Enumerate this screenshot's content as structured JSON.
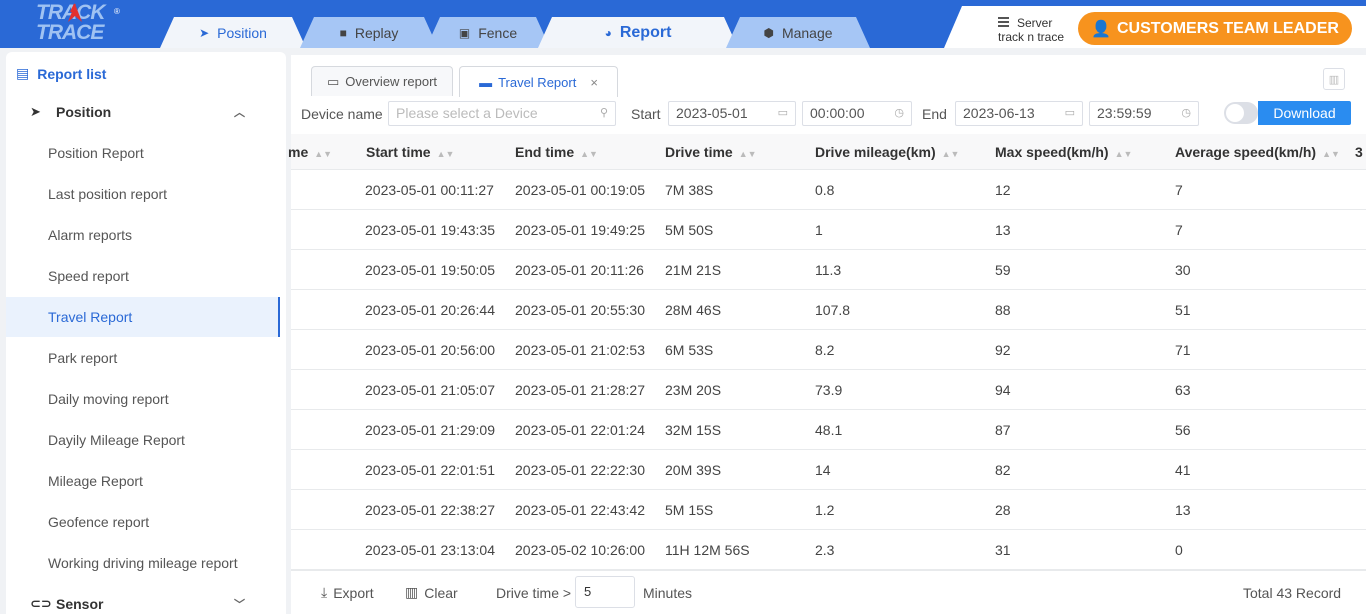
{
  "logo": {
    "line1": "TRACK",
    "line2": "TRACE",
    "mark": "®"
  },
  "nav_tabs": [
    {
      "label": "Position",
      "icon": "paper-plane-icon"
    },
    {
      "label": "Replay",
      "icon": "video-icon"
    },
    {
      "label": "Fence",
      "icon": "fence-icon"
    },
    {
      "label": "Report",
      "icon": "pie-chart-icon"
    },
    {
      "label": "Manage",
      "icon": "cube-icon"
    }
  ],
  "server": {
    "label": "Server",
    "name": "track n trace"
  },
  "user": {
    "name": "CUSTOMERS TEAM LEADER"
  },
  "sidebar": {
    "title": "Report list",
    "groups": [
      {
        "label": "Position",
        "expanded": true
      },
      {
        "label": "Sensor",
        "expanded": false
      }
    ],
    "items": [
      "Position Report",
      "Last position report",
      "Alarm reports",
      "Speed report",
      "Travel Report",
      "Park report",
      "Daily moving report",
      "Dayily Mileage Report",
      "Mileage Report",
      "Geofence report",
      "Working driving mileage report"
    ],
    "active_item": "Travel Report"
  },
  "report_tabs": [
    {
      "label": "Overview report"
    },
    {
      "label": "Travel Report",
      "close": "×"
    }
  ],
  "filters": {
    "device_label": "Device name",
    "device_placeholder": "Please select a Device",
    "start_label": "Start",
    "start_date": "2023-05-01",
    "start_time": "00:00:00",
    "end_label": "End",
    "end_date": "2023-06-13",
    "end_time": "23:59:59",
    "download_label": "Download"
  },
  "table": {
    "columns": [
      "me",
      "Start time",
      "End time",
      "Drive time",
      "Drive mileage(km)",
      "Max speed(km/h)",
      "Average speed(km/h)",
      "3"
    ],
    "rows": [
      [
        "2023-05-01 00:11:27",
        "2023-05-01 00:19:05",
        "7M 38S",
        "0.8",
        "12",
        "7"
      ],
      [
        "2023-05-01 19:43:35",
        "2023-05-01 19:49:25",
        "5M 50S",
        "1",
        "13",
        "7"
      ],
      [
        "2023-05-01 19:50:05",
        "2023-05-01 20:11:26",
        "21M 21S",
        "11.3",
        "59",
        "30"
      ],
      [
        "2023-05-01 20:26:44",
        "2023-05-01 20:55:30",
        "28M 46S",
        "107.8",
        "88",
        "51"
      ],
      [
        "2023-05-01 20:56:00",
        "2023-05-01 21:02:53",
        "6M 53S",
        "8.2",
        "92",
        "71"
      ],
      [
        "2023-05-01 21:05:07",
        "2023-05-01 21:28:27",
        "23M 20S",
        "73.9",
        "94",
        "63"
      ],
      [
        "2023-05-01 21:29:09",
        "2023-05-01 22:01:24",
        "32M 15S",
        "48.1",
        "87",
        "56"
      ],
      [
        "2023-05-01 22:01:51",
        "2023-05-01 22:22:30",
        "20M 39S",
        "14",
        "82",
        "41"
      ],
      [
        "2023-05-01 22:38:27",
        "2023-05-01 22:43:42",
        "5M 15S",
        "1.2",
        "28",
        "13"
      ],
      [
        "2023-05-01 23:13:04",
        "2023-05-02 10:26:00",
        "11H 12M 56S",
        "2.3",
        "31",
        "0"
      ]
    ]
  },
  "footer": {
    "export_label": "Export",
    "clear_label": "Clear",
    "drive_time_label": "Drive time >",
    "drive_time_value": "5",
    "minutes_label": "Minutes",
    "total": "Total 43 Record"
  },
  "colors": {
    "primary": "#2a69d6",
    "accent": "#f7931e",
    "download": "#2a8cf0"
  }
}
